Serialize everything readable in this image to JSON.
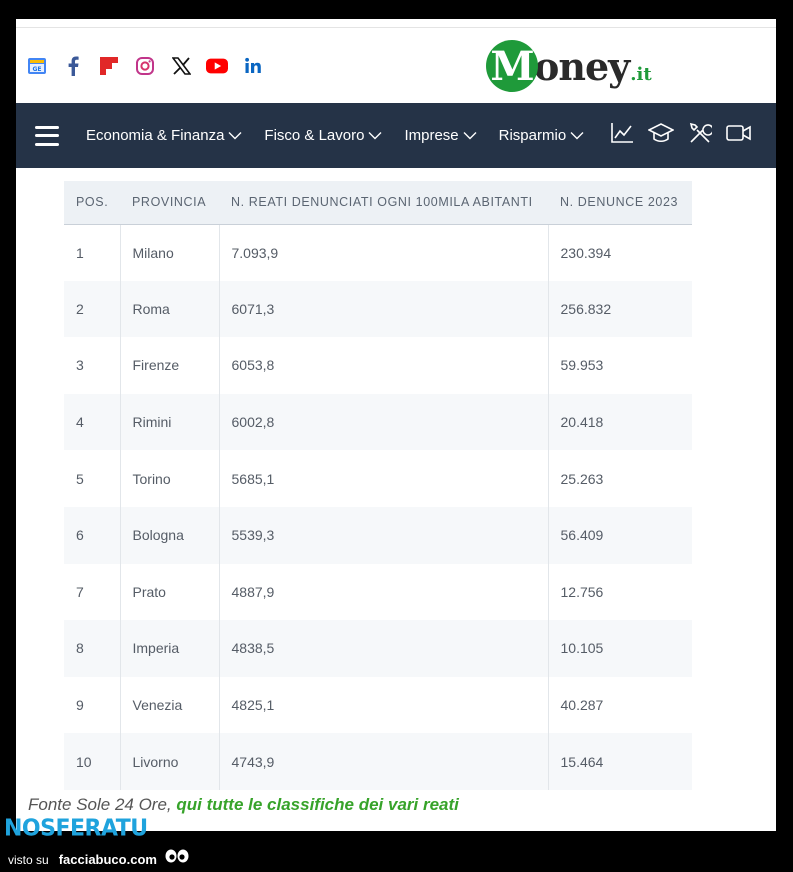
{
  "social": [
    "google-news-icon",
    "facebook-icon",
    "flipboard-icon",
    "instagram-icon",
    "x-icon",
    "youtube-icon",
    "linkedin-icon"
  ],
  "logo": {
    "initial": "M",
    "word": "oney",
    "tld": ".it"
  },
  "nav": {
    "items": [
      {
        "label": "Economia & Finanza"
      },
      {
        "label": "Fisco & Lavoro"
      },
      {
        "label": "Imprese"
      },
      {
        "label": "Risparmio"
      }
    ],
    "tools": [
      "chart-icon",
      "graduation-cap-icon",
      "tools-icon",
      "video-icon"
    ]
  },
  "table": {
    "headers": [
      "POS.",
      "PROVINCIA",
      "N. REATI DENUNCIATI OGNI 100MILA ABITANTI",
      "N. DENUNCE 2023"
    ],
    "rows": [
      [
        "1",
        "Milano",
        "7.093,9",
        "230.394"
      ],
      [
        "2",
        "Roma",
        "6071,3",
        "256.832"
      ],
      [
        "3",
        "Firenze",
        "6053,8",
        "59.953"
      ],
      [
        "4",
        "Rimini",
        "6002,8",
        "20.418"
      ],
      [
        "5",
        "Torino",
        "5685,1",
        "25.263"
      ],
      [
        "6",
        "Bologna",
        "5539,3",
        "56.409"
      ],
      [
        "7",
        "Prato",
        "4887,9",
        "12.756"
      ],
      [
        "8",
        "Imperia",
        "4838,5",
        "10.105"
      ],
      [
        "9",
        "Venezia",
        "4825,1",
        "40.287"
      ],
      [
        "10",
        "Livorno",
        "4743,9",
        "15.464"
      ]
    ]
  },
  "caption": {
    "source": "Fonte Sole 24 Ore, ",
    "link": "qui tutte le classifiche dei vari reati"
  },
  "watermark": {
    "brand": "NOSFERATU",
    "visto": "visto su",
    "site": "facciabuco.com"
  },
  "colors": {
    "nav_bg": "#253347",
    "brand_green": "#1f9a3a",
    "link_green": "#37a32a",
    "watermark_blue": "#1fa3dd"
  }
}
